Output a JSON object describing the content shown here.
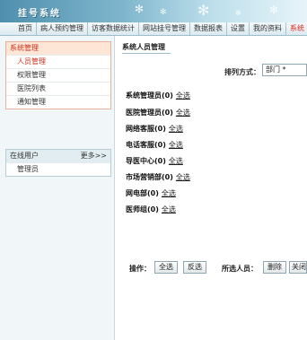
{
  "header": {
    "title": "挂号系统"
  },
  "nav": {
    "items": [
      "首页",
      "病人预约管理",
      "访客数据统计",
      "网站挂号管理",
      "数据报表",
      "设置",
      "我的资料",
      "系统"
    ]
  },
  "sidebar": {
    "system_panel": {
      "title": "系统管理",
      "items": [
        "人员管理",
        "权限管理",
        "医院列表",
        "通知管理"
      ]
    },
    "online_panel": {
      "title": "在线用户",
      "more": "更多>>",
      "users": [
        "管理员"
      ]
    }
  },
  "main": {
    "section_title": "系统人员管理",
    "sort": {
      "label": "排列方式：",
      "value": "部门 *"
    },
    "select_all_label": "全选",
    "groups": [
      {
        "name": "系统管理员",
        "count": "(0)"
      },
      {
        "name": "医院管理员",
        "count": "(0)"
      },
      {
        "name": "网络客服",
        "count": "(0)"
      },
      {
        "name": "电话客服",
        "count": "(0)"
      },
      {
        "name": "导医中心",
        "count": "(0)"
      },
      {
        "name": "市场营销部",
        "count": "(0)"
      },
      {
        "name": "网电部",
        "count": "(0)"
      },
      {
        "name": "医师组",
        "count": "(0)"
      }
    ],
    "operations": {
      "label": "操作：",
      "select_all": "全选",
      "invert": "反选",
      "selected_label": "所选人员：",
      "delete": "删除",
      "close": "关闭"
    }
  }
}
